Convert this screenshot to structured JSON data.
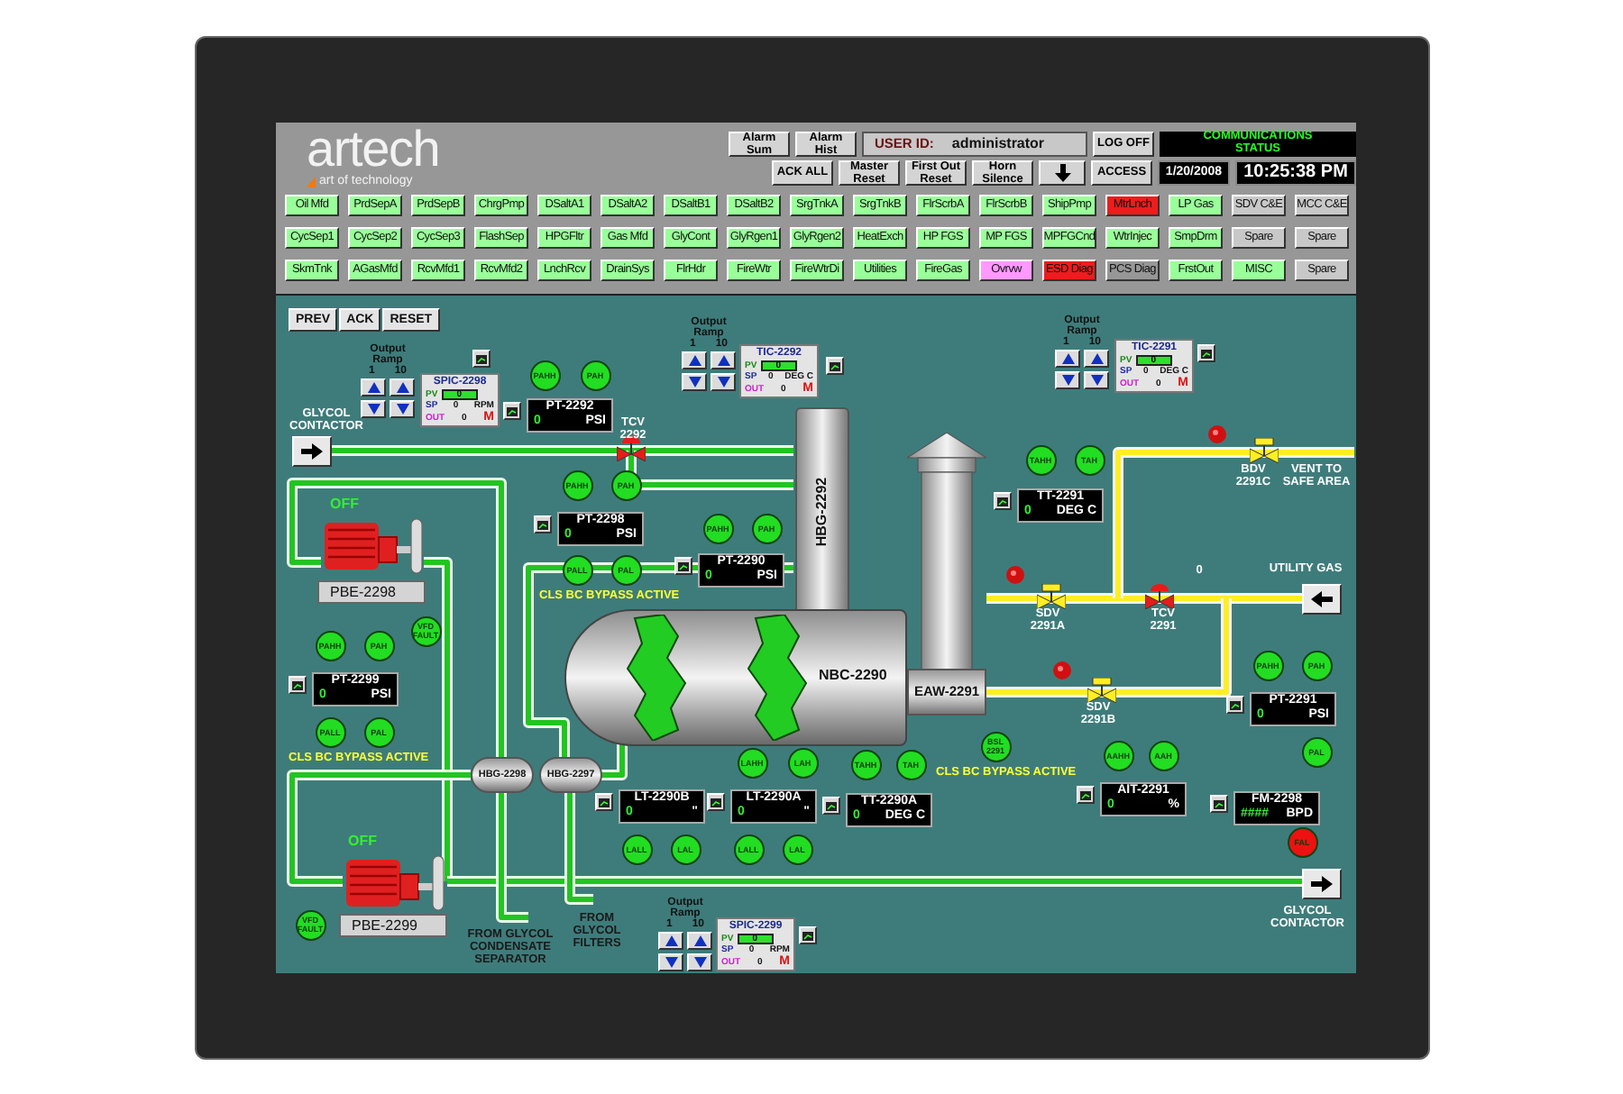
{
  "header": {
    "logo": {
      "name": "artech",
      "tagline": "art of technology"
    },
    "top_row": [
      {
        "kind": "button",
        "label": "Alarm Sum"
      },
      {
        "kind": "button",
        "label": "Alarm Hist"
      },
      {
        "kind": "user",
        "label": "USER ID:",
        "value": "administrator"
      },
      {
        "kind": "button",
        "label": "LOG OFF"
      },
      {
        "kind": "status",
        "label": "COMMUNICATIONS STATUS"
      }
    ],
    "bottom_row": [
      {
        "kind": "button",
        "label": "ACK ALL"
      },
      {
        "kind": "button",
        "label": "Master Reset"
      },
      {
        "kind": "button",
        "label": "First Out Reset"
      },
      {
        "kind": "button",
        "label": "Horn Silence"
      },
      {
        "kind": "arrow"
      },
      {
        "kind": "button",
        "label": "ACCESS"
      },
      {
        "kind": "date",
        "value": "1/20/2008"
      },
      {
        "kind": "clock",
        "value": "10:25:38 PM"
      }
    ]
  },
  "nav_rows": [
    {
      "buttons": [
        {
          "label": "Oil Mfd",
          "color": "#99ff99"
        },
        {
          "label": "PrdSepA",
          "color": "#99ff99"
        },
        {
          "label": "PrdSepB",
          "color": "#99ff99"
        },
        {
          "label": "ChrgPmp",
          "color": "#99ff99"
        },
        {
          "label": "DSaltA1",
          "color": "#99ff99"
        },
        {
          "label": "DSaltA2",
          "color": "#99ff99"
        },
        {
          "label": "DSaltB1",
          "color": "#99ff99"
        },
        {
          "label": "DSaltB2",
          "color": "#99ff99"
        },
        {
          "label": "SrgTnkA",
          "color": "#99ff99"
        },
        {
          "label": "SrgTnkB",
          "color": "#99ff99"
        },
        {
          "label": "FlrScrbA",
          "color": "#99ff99"
        },
        {
          "label": "FlrScrbB",
          "color": "#99ff99"
        },
        {
          "label": "ShipPmp",
          "color": "#99ff99"
        },
        {
          "label": "MtrLnch",
          "color": "#ee1c1c"
        },
        {
          "label": "LP Gas",
          "color": "#99ff99"
        },
        {
          "label": "SDV C&E",
          "color": "#c8c8c8"
        },
        {
          "label": "MCC C&E",
          "color": "#c8c8c8"
        }
      ]
    },
    {
      "buttons": [
        {
          "label": "CycSep1",
          "color": "#99ff99"
        },
        {
          "label": "CycSep2",
          "color": "#99ff99"
        },
        {
          "label": "CycSep3",
          "color": "#99ff99"
        },
        {
          "label": "FlashSep",
          "color": "#99ff99"
        },
        {
          "label": "HPGFltr",
          "color": "#99ff99"
        },
        {
          "label": "Gas Mfd",
          "color": "#99ff99"
        },
        {
          "label": "GlyCont",
          "color": "#99ff99"
        },
        {
          "label": "GlyRgen1",
          "color": "#99ff99"
        },
        {
          "label": "GlyRgen2",
          "color": "#99ff99"
        },
        {
          "label": "HeatExch",
          "color": "#99ff99"
        },
        {
          "label": "HP FGS",
          "color": "#99ff99"
        },
        {
          "label": "MP FGS",
          "color": "#99ff99"
        },
        {
          "label": "MPFGCnd",
          "color": "#99ff99"
        },
        {
          "label": "WtrInjec",
          "color": "#99ff99"
        },
        {
          "label": "SmpDrm",
          "color": "#99ff99"
        },
        {
          "label": "Spare",
          "color": "#c8c8c8"
        },
        {
          "label": "Spare",
          "color": "#c8c8c8"
        }
      ]
    },
    {
      "buttons": [
        {
          "label": "SkmTnk",
          "color": "#99ff99"
        },
        {
          "label": "AGasMfd",
          "color": "#99ff99"
        },
        {
          "label": "RcvMfd1",
          "color": "#99ff99"
        },
        {
          "label": "RcvMfd2",
          "color": "#99ff99"
        },
        {
          "label": "LnchRcv",
          "color": "#99ff99"
        },
        {
          "label": "DrainSys",
          "color": "#99ff99"
        },
        {
          "label": "FlrHdr",
          "color": "#99ff99"
        },
        {
          "label": "FireWtr",
          "color": "#99ff99"
        },
        {
          "label": "FireWtrDi",
          "color": "#99ff99"
        },
        {
          "label": "Utilities",
          "color": "#99ff99"
        },
        {
          "label": "FireGas",
          "color": "#99ff99"
        },
        {
          "label": "Ovrvw",
          "color": "#ff99ff"
        },
        {
          "label": "ESD Diag",
          "color": "#ee1c1c"
        },
        {
          "label": "PCS Diag",
          "color": "#979797"
        },
        {
          "label": "FrstOut",
          "color": "#99ff99"
        },
        {
          "label": "MISC",
          "color": "#99ff99"
        },
        {
          "label": "Spare",
          "color": "#c8c8c8"
        }
      ]
    }
  ],
  "canvas_buttons": [
    "PREV",
    "ACK",
    "RESET"
  ],
  "controllers": [
    {
      "tag": "SPIC-2298",
      "pv_label": "PV",
      "pv": "0",
      "sp_label": "SP",
      "sp": "0",
      "unit": "RPM",
      "out_label": "OUT",
      "out": "0",
      "mode": "M",
      "ramp": {
        "title": "Output Ramp",
        "steps": [
          "1",
          "10"
        ]
      }
    },
    {
      "tag": "TIC-2292",
      "pv_label": "PV",
      "pv": "0",
      "sp_label": "SP",
      "sp": "0",
      "unit": "DEG C",
      "out_label": "OUT",
      "out": "0",
      "mode": "M",
      "ramp": {
        "title": "Output Ramp",
        "steps": [
          "1",
          "10"
        ]
      }
    },
    {
      "tag": "TIC-2291",
      "pv_label": "PV",
      "pv": "0",
      "sp_label": "SP",
      "sp": "0",
      "unit": "DEG C",
      "out_label": "OUT",
      "out": "0",
      "mode": "M",
      "ramp": {
        "title": "Output Ramp",
        "steps": [
          "1",
          "10"
        ]
      }
    },
    {
      "tag": "SPIC-2299",
      "pv_label": "PV",
      "pv": "0",
      "sp_label": "SP",
      "sp": "0",
      "unit": "RPM",
      "out_label": "OUT",
      "out": "0",
      "mode": "M",
      "ramp": {
        "title": "Output Ramp",
        "steps": [
          "1",
          "10"
        ]
      }
    }
  ],
  "readouts": [
    {
      "tag": "PT-2292",
      "value": "0",
      "unit": "PSI"
    },
    {
      "tag": "PT-2298",
      "value": "0",
      "unit": "PSI"
    },
    {
      "tag": "PT-2290",
      "value": "0",
      "unit": "PSI"
    },
    {
      "tag": "PT-2299",
      "value": "0",
      "unit": "PSI"
    },
    {
      "tag": "TT-2291",
      "value": "0",
      "unit": "DEG C"
    },
    {
      "tag": "LT-2290B",
      "value": "0",
      "unit": "\""
    },
    {
      "tag": "LT-2290A",
      "value": "0",
      "unit": "\""
    },
    {
      "tag": "TT-2290A",
      "value": "0",
      "unit": "DEG C"
    },
    {
      "tag": "AIT-2291",
      "value": "0",
      "unit": "%"
    },
    {
      "tag": "PT-2291",
      "value": "0",
      "unit": "PSI"
    },
    {
      "tag": "FM-2298",
      "value": "####",
      "unit": "BPD"
    }
  ],
  "alarms": [
    {
      "label": "PAHH",
      "color": "#22dd22"
    },
    {
      "label": "PAH",
      "color": "#22dd22"
    },
    {
      "label": "PAHH",
      "color": "#22dd22"
    },
    {
      "label": "PAH",
      "color": "#22dd22"
    },
    {
      "label": "PAHH",
      "color": "#22dd22"
    },
    {
      "label": "PAH",
      "color": "#22dd22"
    },
    {
      "label": "PALL",
      "color": "#22dd22"
    },
    {
      "label": "PAL",
      "color": "#22dd22"
    },
    {
      "label": "PAHH",
      "color": "#22dd22"
    },
    {
      "label": "PAH",
      "color": "#22dd22"
    },
    {
      "label": "VFD FAULT",
      "color": "#22dd22"
    },
    {
      "label": "PALL",
      "color": "#22dd22"
    },
    {
      "label": "PAL",
      "color": "#22dd22"
    },
    {
      "label": "VFD FAULT",
      "color": "#22dd22"
    },
    {
      "label": "TAHH",
      "color": "#22dd22"
    },
    {
      "label": "TAH",
      "color": "#22dd22"
    },
    {
      "label": "LAHH",
      "color": "#22dd22"
    },
    {
      "label": "LAH",
      "color": "#22dd22"
    },
    {
      "label": "LALL",
      "color": "#22dd22"
    },
    {
      "label": "LAL",
      "color": "#22dd22"
    },
    {
      "label": "LALL",
      "color": "#22dd22"
    },
    {
      "label": "LAL",
      "color": "#22dd22"
    },
    {
      "label": "TAHH",
      "color": "#22dd22"
    },
    {
      "label": "TAH",
      "color": "#22dd22"
    },
    {
      "label": "BSL 2291",
      "color": "#22dd22"
    },
    {
      "label": "AAHH",
      "color": "#22dd22"
    },
    {
      "label": "AAH",
      "color": "#22dd22"
    },
    {
      "label": "PAHH",
      "color": "#22dd22"
    },
    {
      "label": "PAH",
      "color": "#22dd22"
    },
    {
      "label": "PAL",
      "color": "#22dd22"
    },
    {
      "label": "FAL",
      "color": "#ee1111"
    }
  ],
  "pumps": [
    {
      "tag": "PBE-2298",
      "status": "OFF"
    },
    {
      "tag": "PBE-2299",
      "status": "OFF"
    }
  ],
  "equipment": [
    {
      "kind": "column",
      "tag": "HBG-2292"
    },
    {
      "kind": "vessel",
      "tag": "NBC-2290"
    },
    {
      "kind": "stack",
      "tag": "EAW-2291"
    },
    {
      "kind": "filter",
      "tag": "HBG-2298"
    },
    {
      "kind": "filter",
      "tag": "HBG-2297"
    }
  ],
  "labels": [
    {
      "kind": "tag",
      "text": "GLYCOL CONTACTOR"
    },
    {
      "kind": "tag",
      "text": "TCV 2292"
    },
    {
      "kind": "alert",
      "text": "CLS BC BYPASS ACTIVE"
    },
    {
      "kind": "alert",
      "text": "CLS BC BYPASS ACTIVE"
    },
    {
      "kind": "alert",
      "text": "CLS BC BYPASS ACTIVE"
    },
    {
      "kind": "note",
      "text": "FROM GLYCOL CONDENSATE SEPARATOR"
    },
    {
      "kind": "note",
      "text": "FROM GLYCOL FILTERS"
    },
    {
      "kind": "tag",
      "text": "BDV 2291C"
    },
    {
      "kind": "tag",
      "text": "VENT TO SAFE AREA"
    },
    {
      "kind": "tag",
      "text": "UTILITY GAS"
    },
    {
      "kind": "tag",
      "text": "SDV 2291A"
    },
    {
      "kind": "tag",
      "text": "TCV 2291"
    },
    {
      "kind": "tag",
      "text": "SDV 2291B"
    },
    {
      "kind": "tag",
      "text": "GLYCOL CONTACTOR"
    },
    {
      "kind": "tag",
      "text": "0"
    }
  ]
}
